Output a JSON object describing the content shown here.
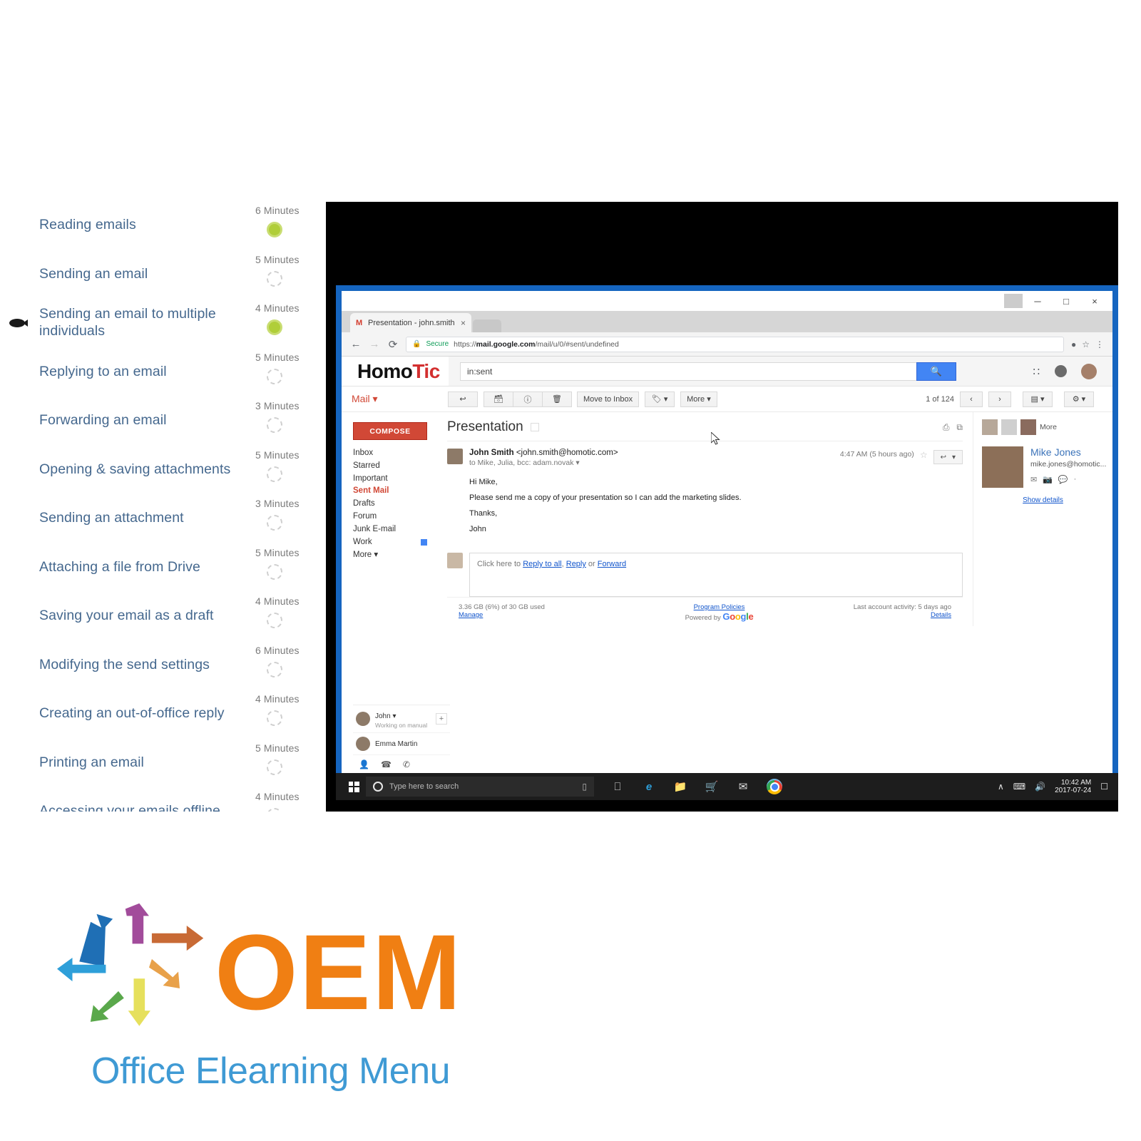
{
  "curriculum": {
    "lessons": [
      {
        "title": "Reading emails",
        "duration": "6 Minutes",
        "status": "done"
      },
      {
        "title": "Sending an email",
        "duration": "5 Minutes",
        "status": "todo"
      },
      {
        "title": "Sending an email to multiple individuals",
        "duration": "4 Minutes",
        "status": "done"
      },
      {
        "title": "Replying to an email",
        "duration": "5 Minutes",
        "status": "todo"
      },
      {
        "title": "Forwarding an email",
        "duration": "3 Minutes",
        "status": "todo"
      },
      {
        "title": "Opening & saving attachments",
        "duration": "5 Minutes",
        "status": "todo"
      },
      {
        "title": "Sending an attachment",
        "duration": "3 Minutes",
        "status": "todo"
      },
      {
        "title": "Attaching a file from Drive",
        "duration": "5 Minutes",
        "status": "todo"
      },
      {
        "title": "Saving your email as a draft",
        "duration": "4 Minutes",
        "status": "todo"
      },
      {
        "title": "Modifying the send settings",
        "duration": "6 Minutes",
        "status": "todo"
      },
      {
        "title": "Creating an out-of-office reply",
        "duration": "4 Minutes",
        "status": "todo"
      },
      {
        "title": "Printing an email",
        "duration": "5 Minutes",
        "status": "todo"
      },
      {
        "title": "Accessing your emails offline",
        "duration": "4 Minutes",
        "status": "todo"
      }
    ]
  },
  "browser": {
    "tab_title": "Presentation - john.smith",
    "tab_close": "×",
    "back_icon": "←",
    "forward_icon": "→",
    "reload_icon": "⟳",
    "lock_icon": "🔒",
    "secure_label": "Secure",
    "url_prefix": "https://",
    "url_domain": "mail.google.com",
    "url_path": "/mail/u/0/#sent/undefined",
    "bookmark_icon": "☆",
    "menu_icon": "⋮",
    "window_minimize": "─",
    "window_maximize": "□",
    "window_close": "×"
  },
  "gmail": {
    "brand_dark": "Homo",
    "brand_red": "Tic",
    "search_value": "in:sent",
    "search_button_icon": "🔍",
    "apps_icon": "∷",
    "mail_menu": "Mail ▾",
    "toolbar": {
      "back_icon": "↩",
      "archive_icon": "🗃",
      "spam_icon": "ⓘ",
      "delete_icon": "🗑",
      "move_to_inbox": "Move to Inbox",
      "labels_icon": "🏷 ▾",
      "more": "More ▾",
      "counter": "1 of 124",
      "prev_icon": "‹",
      "next_icon": "›",
      "density_icon": "▤ ▾",
      "settings_icon": "⚙ ▾"
    },
    "sidebar": {
      "compose": "COMPOSE",
      "labels": [
        {
          "name": "Inbox",
          "active": false
        },
        {
          "name": "Starred",
          "active": false
        },
        {
          "name": "Important",
          "active": false
        },
        {
          "name": "Sent Mail",
          "active": true
        },
        {
          "name": "Drafts",
          "active": false
        },
        {
          "name": "Forum",
          "active": false
        },
        {
          "name": "Junk E-mail",
          "active": false
        },
        {
          "name": "Work",
          "active": false
        },
        {
          "name": "More ▾",
          "active": false
        }
      ]
    },
    "message": {
      "subject": "Presentation",
      "sender_name": "John Smith",
      "sender_email": "<john.smith@homotic.com>",
      "recipients": "to Mike, Julia, bcc: adam.novak ▾",
      "timestamp": "4:47 AM (5 hours ago)",
      "star_icon": "☆",
      "reply_icon": "↩",
      "reply_caret": "▾",
      "print_icon": "⎙",
      "popout_icon": "⧉",
      "greeting": "Hi Mike,",
      "body": "Please send me a copy of your presentation so I can add the marketing slides.",
      "signoff": "Thanks,",
      "signer": "John"
    },
    "reply_prompt_prefix": "Click here to ",
    "reply_all_link": "Reply to all",
    "reply_link": "Reply",
    "reply_or": " or ",
    "forward_link": "Forward",
    "contact_panel": {
      "more_label": "More",
      "name": "Mike Jones",
      "email": "mike.jones@homotic...",
      "action_icons": [
        "✉",
        "📷",
        "💬",
        "·"
      ],
      "details_link": "Show details"
    },
    "footer": {
      "storage": "3.36 GB (6%) of 30 GB used",
      "manage_link": "Manage",
      "policies_link": "Program Policies",
      "powered_by": "Powered by",
      "google_letters": [
        "G",
        "o",
        "o",
        "g",
        "l",
        "e"
      ],
      "activity": "Last account activity: 5 days ago",
      "details_link": "Details"
    },
    "chat": {
      "contacts": [
        {
          "name": "John ▾",
          "status": "Working on manual"
        },
        {
          "name": "Emma Martin",
          "status": ""
        }
      ],
      "plus_icon": "+",
      "tool_icons": [
        "👤",
        "☎",
        "✆"
      ]
    }
  },
  "taskbar": {
    "search_placeholder": "Type here to search",
    "mic_icon": "🎤",
    "icons": [
      "task-view",
      "edge",
      "explorer",
      "store",
      "mail",
      "chrome"
    ],
    "tray_icons": [
      "∧",
      "⌨",
      "🔊"
    ],
    "clock_time": "10:42 AM",
    "clock_date": "2017-07-24"
  },
  "logo": {
    "title": "OEM",
    "subtitle": "Office Elearning Menu",
    "accent": "#f07f13",
    "sub_color": "#3f9ad4"
  }
}
